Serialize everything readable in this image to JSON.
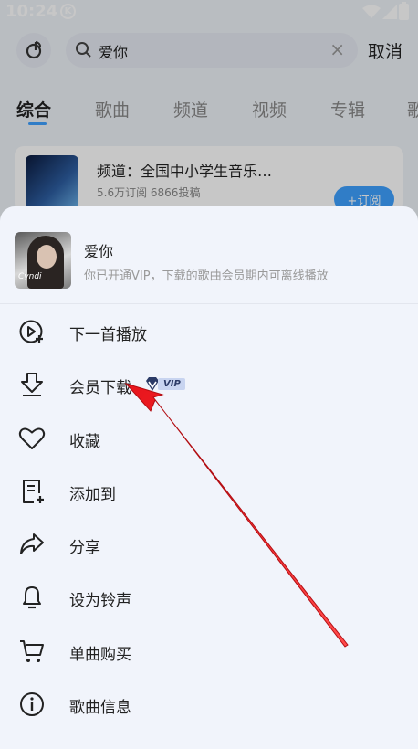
{
  "status_bar": {
    "time": "10:24",
    "k_badge": "K"
  },
  "search": {
    "query": "爱你",
    "clear_symbol": "×",
    "cancel_label": "取消"
  },
  "tabs": [
    {
      "label": "综合",
      "active": true
    },
    {
      "label": "歌曲",
      "active": false
    },
    {
      "label": "频道",
      "active": false
    },
    {
      "label": "视频",
      "active": false
    },
    {
      "label": "专辑",
      "active": false
    },
    {
      "label": "歌",
      "active": false
    }
  ],
  "channel_card": {
    "title": "频道：全国中小学生音乐…",
    "stats": "5.6万订阅 6866投稿",
    "subscribe_label": "+订阅"
  },
  "sheet": {
    "song_title": "爱你",
    "song_subtitle": "你已开通VIP，下载的歌曲会员期内可离线播放",
    "cover_signature": "Cyndi",
    "menu": [
      {
        "label": "下一首播放",
        "icon": "play-next-icon"
      },
      {
        "label": "会员下载",
        "icon": "download-icon",
        "badge": "VIP"
      },
      {
        "label": "收藏",
        "icon": "heart-icon"
      },
      {
        "label": "添加到",
        "icon": "add-to-list-icon"
      },
      {
        "label": "分享",
        "icon": "share-icon"
      },
      {
        "label": "设为铃声",
        "icon": "bell-icon"
      },
      {
        "label": "单曲购买",
        "icon": "cart-icon"
      },
      {
        "label": "歌曲信息",
        "icon": "info-icon"
      }
    ]
  },
  "colors": {
    "accent": "#3ea0ff",
    "sheet_bg": "#f1f4fb",
    "arrow": "#e8141b"
  }
}
